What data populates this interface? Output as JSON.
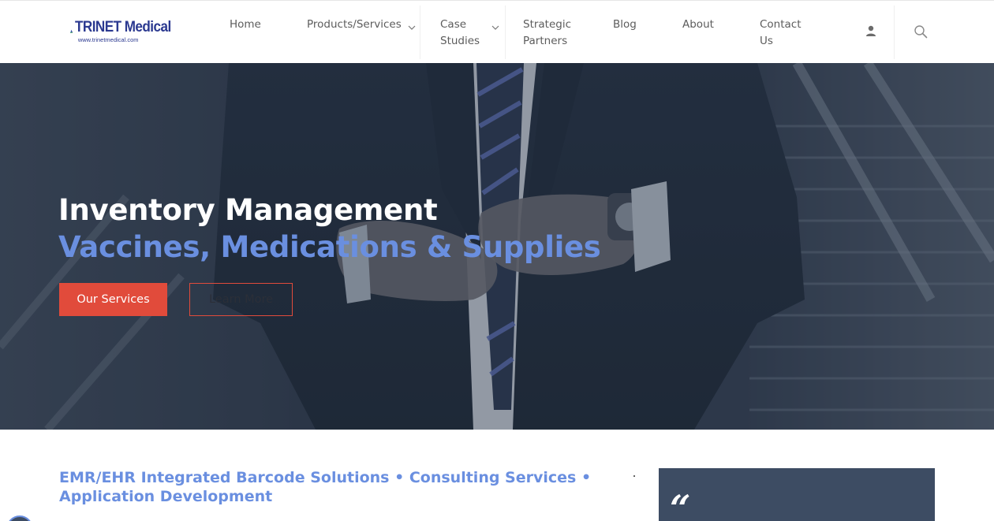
{
  "header": {
    "logo": {
      "name": "TRINET Medical",
      "url_text": "www.trinetmedical.com",
      "colors": {
        "blue": "#2b3990",
        "green": "#3aa655",
        "light_blue": "#6aa7d8"
      }
    },
    "nav": [
      {
        "label": "Home",
        "has_dropdown": false
      },
      {
        "label": "Products/Services",
        "has_dropdown": true
      },
      {
        "label": "Case Studies",
        "line1": "Case",
        "line2": "Studies",
        "has_dropdown": true
      },
      {
        "label": "Strategic Partners",
        "line1": "Strategic",
        "line2": "Partners",
        "has_dropdown": false
      },
      {
        "label": "Blog",
        "has_dropdown": false
      },
      {
        "label": "About",
        "has_dropdown": false
      },
      {
        "label": "Contact Us",
        "line1": "Contact",
        "line2": "Us",
        "has_dropdown": false
      }
    ],
    "icons": [
      "user-icon",
      "search-icon"
    ]
  },
  "hero": {
    "title": "Inventory Management",
    "subtitle": "Vaccines, Medications & Supplies",
    "primary_button": "Our Services",
    "secondary_button": "Learn More",
    "colors": {
      "accent": "#e14b3b",
      "subtitle": "#6a8fe0",
      "overlay": "#2a3648"
    }
  },
  "content": {
    "tagline": "EMR/EHR Integrated Barcode Solutions • Consulting Services • Application Development",
    "quote_mark": "“",
    "colors": {
      "card": "#3d4c63"
    }
  }
}
